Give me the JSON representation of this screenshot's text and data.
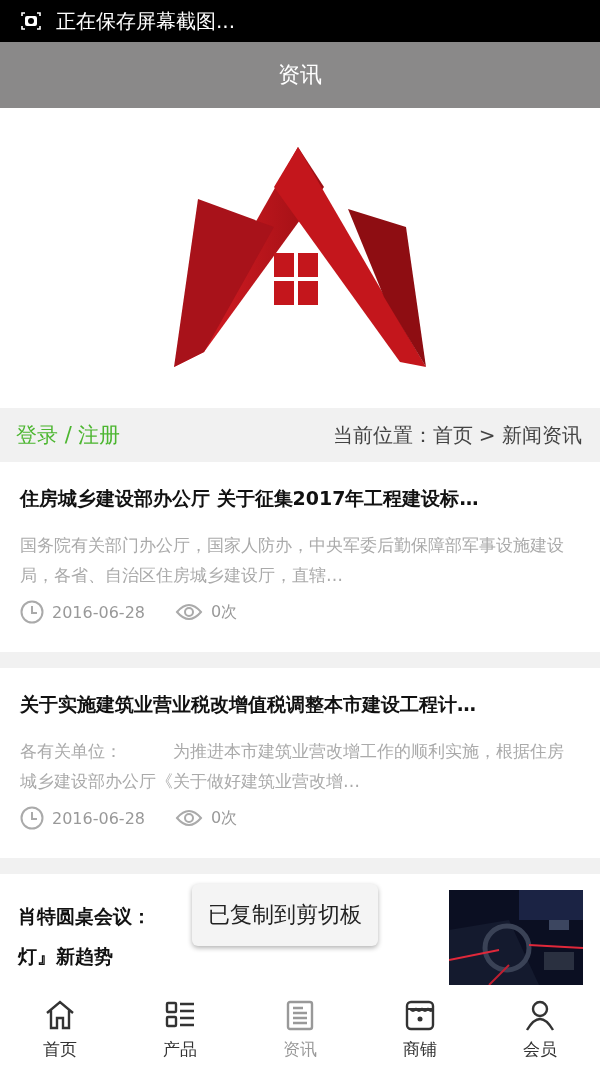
{
  "status_bar": {
    "notification": "正在保存屏幕截图..."
  },
  "header": {
    "title": "资讯"
  },
  "breadcrumb": {
    "login": "登录 / 注册",
    "location": "当前位置：首页 > 新闻资讯"
  },
  "articles": [
    {
      "kind": "text",
      "title": "住房城乡建设部办公厅 关于征集2017年工程建设标…",
      "summary": "国务院有关部门办公厅，国家人防办，中央军委后勤保障部军事设施建设局，各省、自治区住房城乡建设厅，直辖…",
      "date": "2016-06-28",
      "views": "0次"
    },
    {
      "kind": "text",
      "title": "关于实施建筑业营业税改增值税调整本市建设工程计…",
      "summary": "各有关单位：　　　为推进本市建筑业营改增工作的顺利实施，根据住房城乡建设部办公厅《关于做好建筑业营改增…",
      "date": "2016-06-28",
      "views": "0次"
    },
    {
      "title_lines": [
        "肖特圆桌会议：",
        "灯』新趋势"
      ]
    }
  ],
  "toast": "已复制到剪切板",
  "tabs": [
    {
      "label": "首页",
      "kind": "home",
      "selected": false
    },
    {
      "label": "产品",
      "kind": "list",
      "selected": false
    },
    {
      "label": "资讯",
      "kind": "news",
      "selected": true
    },
    {
      "label": "商铺",
      "kind": "shop",
      "selected": false
    },
    {
      "label": "会员",
      "kind": "user",
      "selected": false
    }
  ]
}
